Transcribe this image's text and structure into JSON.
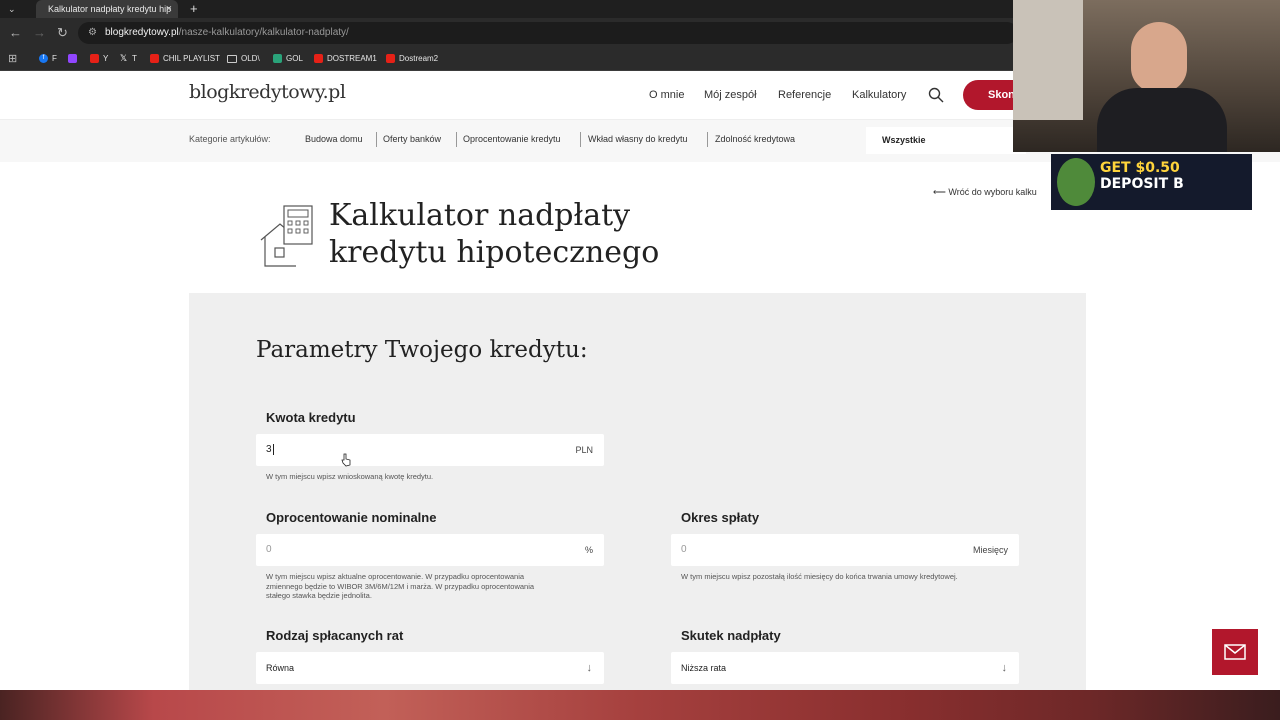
{
  "browser": {
    "tab_title": "Kalkulator nadpłaty kredytu hip",
    "url_host": "blogkredytowy.pl",
    "url_path": "/nasze-kalkulatory/kalkulator-nadplaty/",
    "bookmarks": [
      "F",
      "Y",
      "T",
      "CHIL PLAYLIST",
      "OLD\\",
      "GOL",
      "DOSTREAM1",
      "Dostream2"
    ]
  },
  "site": {
    "logo": "blogkredytowy.pl",
    "nav": [
      "O mnie",
      "Mój zespół",
      "Referencje",
      "Kalkulatory"
    ],
    "cta_label": "Skon",
    "accent_color": "#b2172c"
  },
  "categories": {
    "label": "Kategorie artykułów:",
    "items": [
      "Budowa domu",
      "Oferty banków",
      "Oprocentowanie kredytu",
      "Wkład własny do kredytu",
      "Zdolność kredytowa"
    ],
    "select_value": "Wszystkie"
  },
  "page": {
    "back_link": "Wróć do wyboru kalku",
    "title_line1": "Kalkulator nadpłaty",
    "title_line2": "kredytu hipotecznego"
  },
  "form": {
    "heading": "Parametry Twojego kredytu:",
    "kwota": {
      "label": "Kwota kredytu",
      "value": "3",
      "unit": "PLN",
      "hint": "W tym miejscu wpisz wnioskowaną kwotę kredytu."
    },
    "oprocentowanie": {
      "label": "Oprocentowanie nominalne",
      "placeholder": "0",
      "unit": "%",
      "hint_lines": [
        "W tym miejscu wpisz aktualne oprocentowanie. W przypadku oprocentowania",
        "zmiennego będzie to WIBOR 3M/6M/12M i marża. W przypadku oprocentowania",
        "stałego stawka będzie jednolita."
      ]
    },
    "okres": {
      "label": "Okres spłaty",
      "placeholder": "0",
      "unit": "Miesięcy",
      "hint": "W tym miejscu wpisz pozostałą ilość miesięcy do końca trwania umowy kredytowej."
    },
    "rodzaj": {
      "label": "Rodzaj spłacanych rat",
      "value": "Równa"
    },
    "skutek": {
      "label": "Skutek nadpłaty",
      "value": "Niższa rata"
    }
  },
  "overlay": {
    "ad_line1": "GET $0.50",
    "ad_line2": "DEPOSIT B"
  }
}
